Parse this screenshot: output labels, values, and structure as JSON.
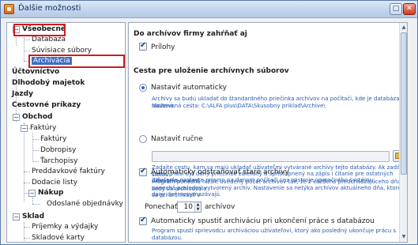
{
  "window": {
    "title": "Ďalšie možnosti"
  },
  "tree": {
    "items": [
      {
        "label": "Všeobecné"
      },
      {
        "label": "Databáza"
      },
      {
        "label": "Súvisiace súbory"
      },
      {
        "label": "Archivácia"
      },
      {
        "label": "Účtovníctvo"
      },
      {
        "label": "Dlhodobý majetok"
      },
      {
        "label": "Jazdy"
      },
      {
        "label": "Cestovné príkazy"
      },
      {
        "label": "Obchod"
      },
      {
        "label": "Faktúry"
      },
      {
        "label": "Faktúry"
      },
      {
        "label": "Dobropisy"
      },
      {
        "label": "Ťarchopisy"
      },
      {
        "label": "Preddavkové faktúry"
      },
      {
        "label": "Dodacie listy"
      },
      {
        "label": "Nákup"
      },
      {
        "label": "Odoslané objednávky"
      },
      {
        "label": "Sklad"
      },
      {
        "label": "Príjemky a výdajky"
      },
      {
        "label": "Skladové karty"
      }
    ],
    "toggle_open": "−"
  },
  "panel": {
    "section1_heading": "Do archívov firmy zahŕňať aj",
    "prilohy_label": "Prílohy",
    "section2_heading": "Cesta pre uloženie archívnych súborov",
    "auto_label": "Nastaviť automaticky",
    "auto_note": "Archívy sa budú ukladať do štandardného priečinka archívov na počítači, kde je databáza uložená.",
    "auto_path": "Nastavená cesta: C:\\ALFA plus\\DATA\\Skusobny priklad\\Archive\\",
    "manual_label": "Nastaviť ručne",
    "manual_note_1": "Zadajte cestu, kam sa majú ukladať užívateľmi vytvárané archívy tejto databázy. Ak zadáte sieťovú",
    "manual_note_2": "cestu, musí byť daný priečinok zdieľaný a sprístupnený na zápis i čítanie pre ostatných užívateľov v sieti.",
    "manual_note_3": "Zdieľanie nastavte priamo na danom počítači cez nástroje operačného systému.",
    "remove_label": "Automaticky odstraňovať staré archívy",
    "remove_note_1": "Program ponechá nižšie uvedený počet archívov tak, že z každého predchádzajúceho dňa kedy sa archivovalo",
    "remove_note_2": "ponechá posledný vytvorený archív. Nastavenie sa netýka archívov aktuálneho dňa, ktoré sa pri archivácii v",
    "remove_note_3": "daný deň nevymazávajú.",
    "keep_label": "Ponechať",
    "keep_value": "10",
    "keep_unit": "archívov",
    "autostart_label": "Automaticky spustiť archiváciu pri ukončení práce s databázou",
    "autostart_note": "Program spustí sprievodcu archiváciou užívateľovi, ktorý ako posledný ukončuje prácu s databázou.",
    "prilohy_checked": true,
    "auto_selected": true,
    "manual_selected": false,
    "remove_checked": true,
    "autostart_checked": true
  },
  "colors": {
    "selection": "#3a6fc9",
    "highlight_box": "#d11b1b",
    "note_text": "#2a5db0"
  }
}
